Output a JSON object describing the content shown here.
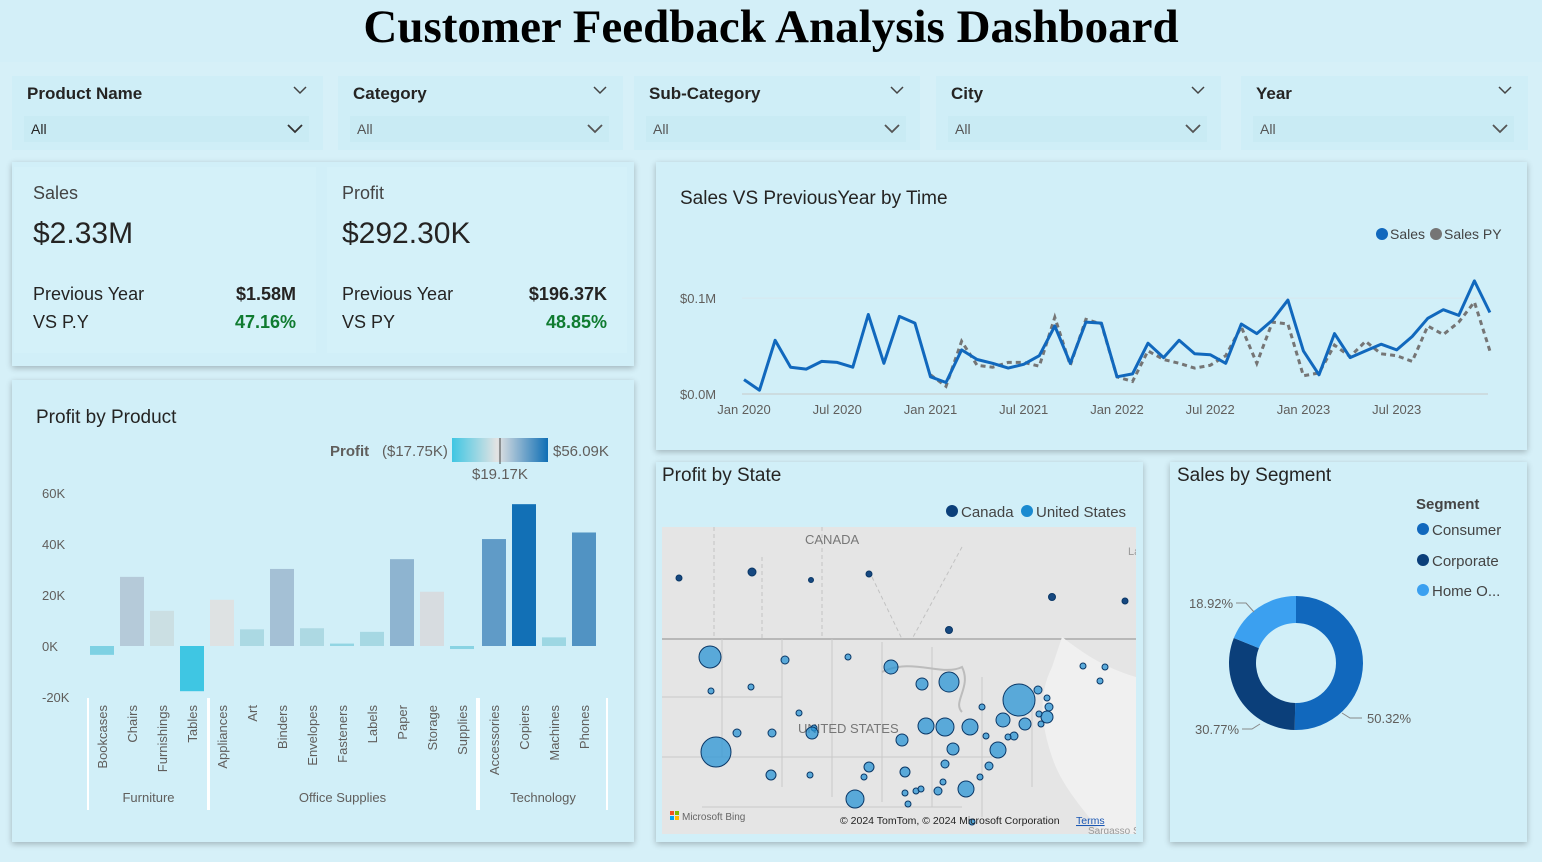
{
  "header": {
    "title": "Customer Feedback Analysis Dashboard"
  },
  "slicers": [
    {
      "label": "Product Name",
      "value": "All"
    },
    {
      "label": "Category",
      "value": "All"
    },
    {
      "label": "Sub-Category",
      "value": "All"
    },
    {
      "label": "City",
      "value": "All"
    },
    {
      "label": "Year",
      "value": "All"
    }
  ],
  "kpis": {
    "sales": {
      "title": "Sales",
      "value": "$2.33M",
      "py_label": "Previous Year",
      "py_value": "$1.58M",
      "vs_label": "VS P.Y",
      "vs_value": "47.16%"
    },
    "profit": {
      "title": "Profit",
      "value": "$292.30K",
      "py_label": "Previous Year",
      "py_value": "$196.37K",
      "vs_label": "VS PY",
      "vs_value": "48.85%"
    }
  },
  "colors": {
    "accent": "#1168bd",
    "py": "#757575",
    "positive": "#0f7b30",
    "corporate": "#0b3f7a",
    "home_office": "#3ba0f0",
    "canada": "#0b3f7a",
    "united_states": "#1a8ad0"
  },
  "chart_data": [
    {
      "type": "line",
      "title": "Sales VS PreviousYear by Time",
      "x_tick_labels": [
        "Jan 2020",
        "Jul 2020",
        "Jan 2021",
        "Jul 2021",
        "Jan 2022",
        "Jul 2022",
        "Jan 2023",
        "Jul 2023"
      ],
      "y_tick_labels": [
        "$0.0M",
        "$0.1M"
      ],
      "ylim": [
        0,
        0.12
      ],
      "legend_position": "top-right",
      "series": [
        {
          "name": "Sales",
          "values": [
            0.015,
            0.004,
            0.056,
            0.028,
            0.026,
            0.034,
            0.033,
            0.028,
            0.083,
            0.032,
            0.081,
            0.074,
            0.018,
            0.012,
            0.046,
            0.036,
            0.032,
            0.027,
            0.031,
            0.04,
            0.071,
            0.032,
            0.075,
            0.074,
            0.018,
            0.021,
            0.053,
            0.038,
            0.056,
            0.042,
            0.041,
            0.032,
            0.073,
            0.063,
            0.077,
            0.098,
            0.045,
            0.02,
            0.063,
            0.038,
            0.045,
            0.052,
            0.046,
            0.06,
            0.079,
            0.088,
            0.082,
            0.118,
            0.085
          ]
        },
        {
          "name": "Sales PY",
          "values": [
            null,
            null,
            null,
            null,
            null,
            null,
            null,
            null,
            null,
            null,
            null,
            null,
            0.02,
            0.008,
            0.055,
            0.03,
            0.028,
            0.033,
            0.033,
            0.029,
            0.08,
            0.03,
            0.078,
            0.073,
            0.018,
            0.013,
            0.045,
            0.036,
            0.032,
            0.027,
            0.03,
            0.04,
            0.07,
            0.032,
            0.075,
            0.073,
            0.019,
            0.022,
            0.051,
            0.039,
            0.055,
            0.042,
            0.04,
            0.034,
            0.071,
            0.062,
            0.075,
            0.096,
            0.045
          ]
        }
      ]
    },
    {
      "type": "bar",
      "title": "Profit by Product",
      "legend": {
        "label": "Profit",
        "min": "($17.75K)",
        "max": "$56.09K",
        "mid": "$19.17K"
      },
      "y_tick_labels": [
        "60K",
        "40K",
        "20K",
        "0K",
        "-20K"
      ],
      "ylim": [
        -20000,
        60000
      ],
      "groups": [
        "Furniture",
        "Office Supplies",
        "Technology"
      ],
      "categories": [
        "Bookcases",
        "Chairs",
        "Furnishings",
        "Tables",
        "Appliances",
        "Art",
        "Binders",
        "Envelopes",
        "Fasteners",
        "Labels",
        "Paper",
        "Storage",
        "Supplies",
        "Accessories",
        "Copiers",
        "Machines",
        "Phones"
      ],
      "values": [
        -3472,
        27118,
        13797,
        -17725,
        18138,
        6528,
        30222,
        6964,
        950,
        5546,
        34053,
        21279,
        -1189,
        41937,
        55618,
        3385,
        44516
      ]
    },
    {
      "type": "pie",
      "title": "Sales by Segment",
      "legend_title": "Segment",
      "legend_position": "right",
      "categories": [
        "Consumer",
        "Corporate",
        "Home O..."
      ],
      "values": [
        50.32,
        30.77,
        18.92
      ],
      "labels": [
        "50.32%",
        "30.77%",
        "18.92%"
      ]
    }
  ],
  "map": {
    "title": "Profit by State",
    "legend": [
      "Canada",
      "United States"
    ],
    "labels": {
      "canada": "CANADA",
      "us": "UNITED STATES"
    },
    "attribution": "© 2024 TomTom, © 2024 Microsoft Corporation",
    "terms": "Terms",
    "bing": "Microsoft Bing",
    "corner": "Sargasso S",
    "corner_top": "La"
  }
}
